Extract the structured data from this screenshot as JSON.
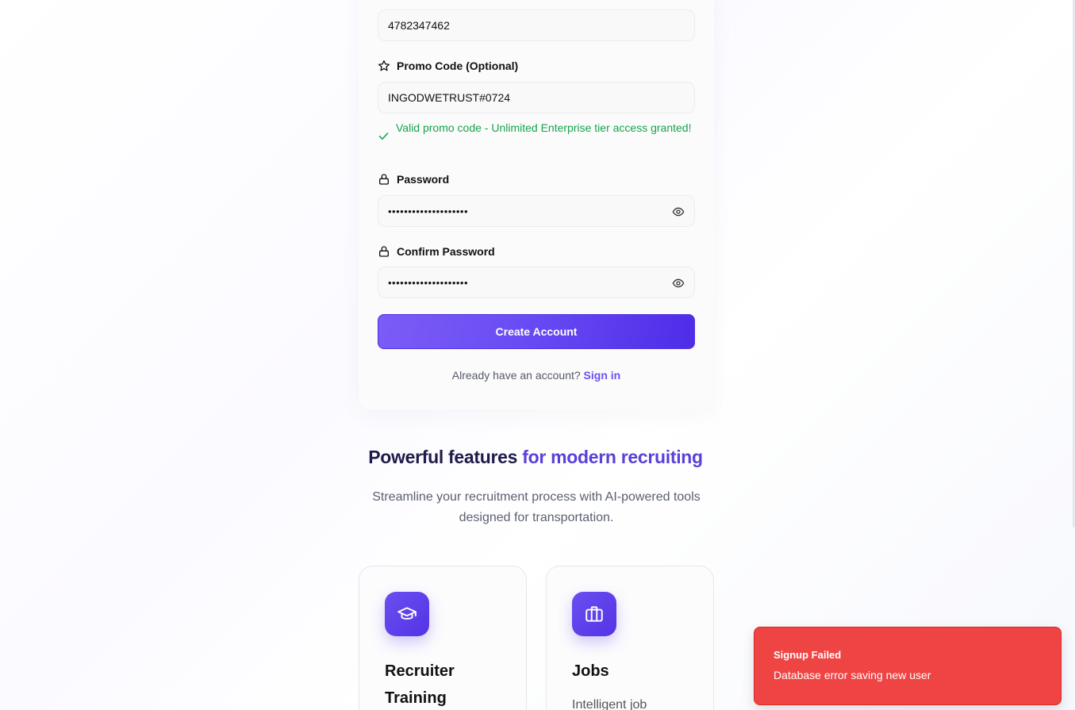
{
  "signup_form": {
    "phone_value": "4782347462",
    "promo": {
      "label": "Promo Code (Optional)",
      "value": "INGODWETRUST#0724",
      "success_message": "Valid promo code - Unlimited Enterprise tier access granted!"
    },
    "password": {
      "label": "Password",
      "value": "••••••••••••••••••••"
    },
    "confirm_password": {
      "label": "Confirm Password",
      "value": "••••••••••••••••••••"
    },
    "create_button": "Create Account",
    "signin_prompt": "Already have an account?",
    "signin_link": "Sign in"
  },
  "features": {
    "title_part1": "Powerful features ",
    "title_part2": "for ",
    "title_part3": "modern recruiting",
    "subtitle": "Streamline your recruitment process with AI-powered tools designed for transportation.",
    "cards": [
      {
        "icon": "graduation-cap-icon",
        "title": "Recruiter Training",
        "desc": ""
      },
      {
        "icon": "briefcase-icon",
        "title": "Jobs",
        "desc": "Intelligent job"
      }
    ]
  },
  "toast": {
    "title": "Signup Failed",
    "message": "Database error saving new user"
  },
  "colors": {
    "accent": "#5b40d9",
    "success": "#16a34a",
    "error": "#ef4444"
  }
}
